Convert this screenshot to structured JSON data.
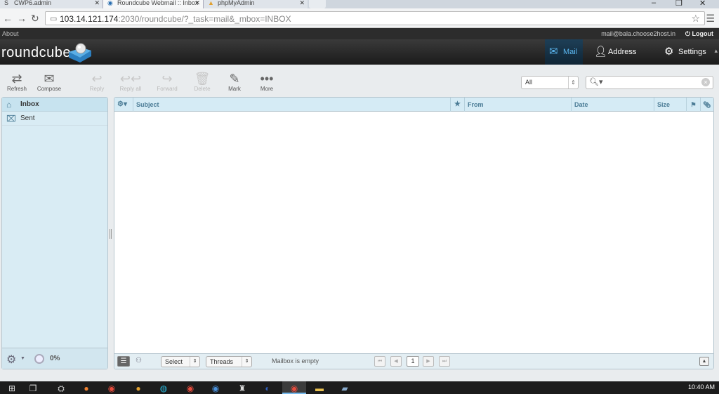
{
  "browser": {
    "tabs": [
      {
        "title": "CWP6.admin",
        "icon": "S",
        "close": "✕"
      },
      {
        "title": "Roundcube Webmail :: Inbox",
        "icon": "◉",
        "close": "✕"
      },
      {
        "title": "phpMyAdmin",
        "icon": "▲",
        "close": "✕"
      }
    ],
    "url_host": "103.14.121.174",
    "url_rest": ":2030/roundcube/?_task=mail&_mbox=INBOX",
    "win_controls": [
      "–",
      "❐",
      "✕"
    ]
  },
  "topline": {
    "about": "About",
    "email": "mail@bala.choose2host.in",
    "logout": "Logout"
  },
  "header": {
    "logo": "roundcube",
    "tasks": {
      "mail": "Mail",
      "address_book": "Address Book",
      "settings": "Settings"
    }
  },
  "toolbar": {
    "refresh": "Refresh",
    "compose": "Compose",
    "reply": "Reply",
    "reply_all": "Reply all",
    "forward": "Forward",
    "delete": "Delete",
    "mark": "Mark",
    "more": "More",
    "filter": "All",
    "search_placeholder": ""
  },
  "folders": [
    {
      "name": "Inbox"
    },
    {
      "name": "Sent"
    }
  ],
  "quota": "0%",
  "messagelist": {
    "columns": {
      "subject": "Subject",
      "from": "From",
      "date": "Date",
      "size": "Size"
    },
    "footer": {
      "select": "Select",
      "threads": "Threads",
      "status": "Mailbox is empty",
      "page": "1"
    }
  },
  "taskbar": {
    "clock": "10:40 AM"
  },
  "colors": {
    "accent": "#5bb6f0",
    "panel_bg": "#d9ecf4",
    "header_bg": "#2c2c2c"
  }
}
